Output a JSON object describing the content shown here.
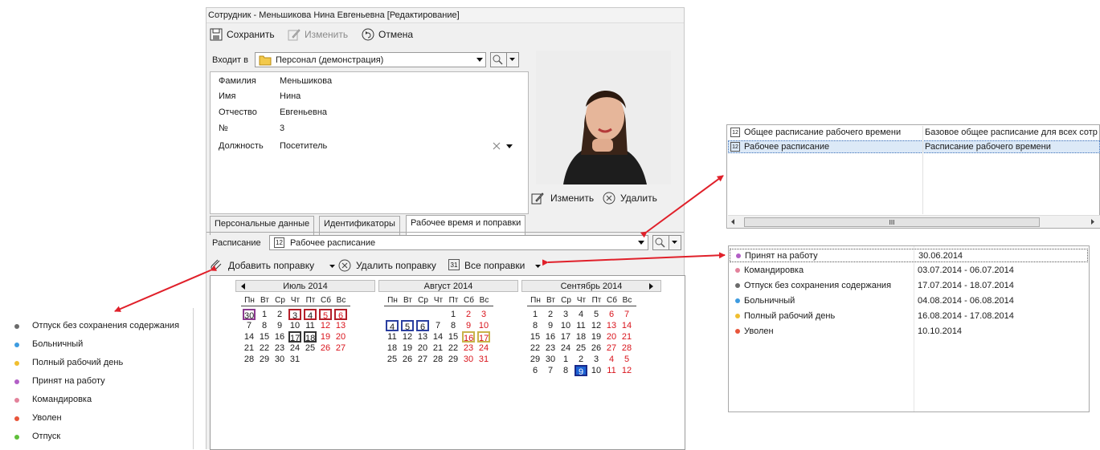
{
  "window": {
    "title": "Сотрудник - Меньшикова Нина Евгеньевна [Редактирование]"
  },
  "toolbar": {
    "save": "Сохранить",
    "edit": "Изменить",
    "cancel": "Отмена"
  },
  "group": {
    "label": "Входит в",
    "value": "Персонал (демонстрация)"
  },
  "fields": [
    {
      "label": "Фамилия",
      "value": "Меньшикова"
    },
    {
      "label": "Имя",
      "value": "Нина"
    },
    {
      "label": "Отчество",
      "value": "Евгеньевна"
    },
    {
      "label": "№",
      "value": "3"
    },
    {
      "label": "Должность",
      "value": "Посетитель"
    }
  ],
  "photo_actions": {
    "edit": "Изменить",
    "delete": "Удалить"
  },
  "tabs": [
    "Персональные данные",
    "Идентификаторы",
    "Рабочее время и поправки"
  ],
  "schedule": {
    "label": "Расписание",
    "value": "Рабочее расписание",
    "icon_text": "12"
  },
  "corrections_toolbar": {
    "add": "Добавить поправку",
    "delete": "Удалить поправку",
    "all": "Все поправки",
    "all_icon_text": "31"
  },
  "calendar": {
    "weekdays": [
      "Пн",
      "Вт",
      "Ср",
      "Чт",
      "Пт",
      "Сб",
      "Вс"
    ],
    "months": [
      {
        "name": "Июль 2014",
        "rows": [
          [
            "30",
            "1",
            "2",
            "3",
            "4",
            "5",
            "6"
          ],
          [
            "7",
            "8",
            "9",
            "10",
            "11",
            "12",
            "13"
          ],
          [
            "14",
            "15",
            "16",
            "17",
            "18",
            "19",
            "20"
          ],
          [
            "21",
            "22",
            "23",
            "24",
            "25",
            "26",
            "27"
          ],
          [
            "28",
            "29",
            "30",
            "31",
            "",
            "",
            ""
          ]
        ]
      },
      {
        "name": "Август 2014",
        "rows": [
          [
            "",
            "",
            "",
            "",
            "1",
            "2",
            "3"
          ],
          [
            "4",
            "5",
            "6",
            "7",
            "8",
            "9",
            "10"
          ],
          [
            "11",
            "12",
            "13",
            "14",
            "15",
            "16",
            "17"
          ],
          [
            "18",
            "19",
            "20",
            "21",
            "22",
            "23",
            "24"
          ],
          [
            "25",
            "26",
            "27",
            "28",
            "29",
            "30",
            "31"
          ]
        ]
      },
      {
        "name": "Сентябрь 2014",
        "rows": [
          [
            "1",
            "2",
            "3",
            "4",
            "5",
            "6",
            "7"
          ],
          [
            "8",
            "9",
            "10",
            "11",
            "12",
            "13",
            "14"
          ],
          [
            "15",
            "16",
            "17",
            "18",
            "19",
            "20",
            "21"
          ],
          [
            "22",
            "23",
            "24",
            "25",
            "26",
            "27",
            "28"
          ],
          [
            "29",
            "30",
            "1",
            "2",
            "3",
            "4",
            "5"
          ],
          [
            "6",
            "7",
            "8",
            "9",
            "10",
            "11",
            "12"
          ]
        ]
      }
    ]
  },
  "schedule_popup": {
    "rows": [
      {
        "name": "Общее расписание рабочего времени",
        "desc": "Базовое общее расписание для всех сотр",
        "icon_text": "12"
      },
      {
        "name": "Рабочее расписание",
        "desc": "Расписание рабочего времени",
        "icon_text": "12"
      }
    ],
    "scroll_thumb": "III"
  },
  "corrections_list": [
    {
      "name": "Принят на работу",
      "dates": "30.06.2014",
      "color": "#b25fc6"
    },
    {
      "name": "Командировка",
      "dates": "03.07.2014 - 06.07.2014",
      "color": "#e3829b"
    },
    {
      "name": "Отпуск без сохранения содержания",
      "dates": "17.07.2014 - 18.07.2014",
      "color": "#6b6b6b"
    },
    {
      "name": "Больничный",
      "dates": "04.08.2014 - 06.08.2014",
      "color": "#3d9be0"
    },
    {
      "name": "Полный рабочий день",
      "dates": "16.08.2014 - 17.08.2014",
      "color": "#f0be2f"
    },
    {
      "name": "Уволен",
      "dates": "10.10.2014",
      "color": "#e8553a"
    }
  ],
  "types_menu": [
    {
      "name": "Отпуск без сохранения содержания",
      "color": "#6b6b6b"
    },
    {
      "name": "Больничный",
      "color": "#3d9be0"
    },
    {
      "name": "Полный рабочий день",
      "color": "#f0be2f"
    },
    {
      "name": "Принят на работу",
      "color": "#b25fc6"
    },
    {
      "name": "Командировка",
      "color": "#e3829b"
    },
    {
      "name": "Уволен",
      "color": "#e8553a"
    },
    {
      "name": "Отпуск",
      "color": "#5fbf3a"
    }
  ],
  "colors": {
    "arrow": "#e0202a",
    "weekend": "#d9141c",
    "selected": "#1e63d4"
  }
}
